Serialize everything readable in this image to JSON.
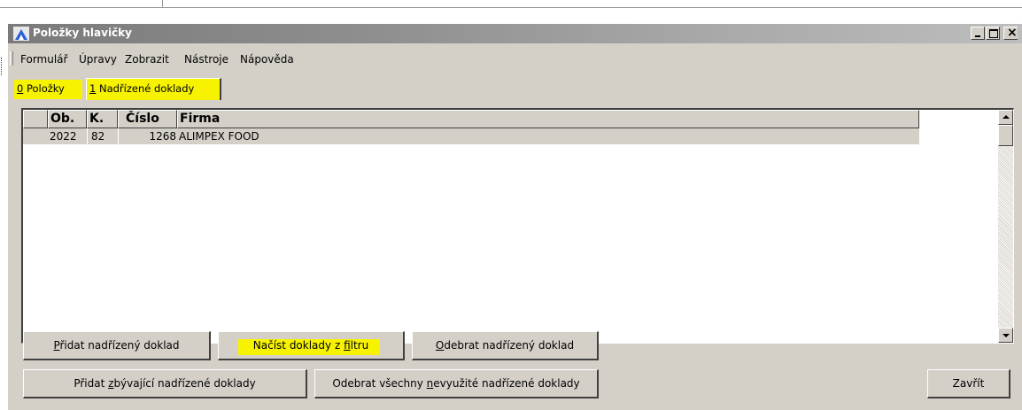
{
  "window": {
    "title": "Položky hlavičky",
    "controls": {
      "minimize": "minimize",
      "maximize": "maximize",
      "close": "×"
    }
  },
  "menu": [
    "Formulář",
    "Úpravy",
    "Zobrazit",
    "Nástroje",
    "Nápověda"
  ],
  "tabs": [
    {
      "key": "0",
      "label": " Položky",
      "highlighted": true,
      "active": false
    },
    {
      "key": "1",
      "label": " Nadřízené doklady",
      "highlighted": true,
      "active": true
    }
  ],
  "grid": {
    "columns": [
      "",
      "Ob.",
      "K.",
      "Číslo",
      "Firma"
    ],
    "rows": [
      {
        "ob": "2022",
        "k": "82",
        "cislo": "1268",
        "firma": "ALIMPEX FOOD"
      }
    ]
  },
  "buttons": {
    "pridat_prefix": "P",
    "pridat_rest": "řidat nadřízený doklad",
    "nacist_prefix": "Načíst doklady z ",
    "nacist_u": "f",
    "nacist_rest": "iltru",
    "odebrat_prefix": "O",
    "odebrat_rest": "debrat nadřízený doklad",
    "zbyvajici_prefix": "Přidat ",
    "zbyvajici_u": "z",
    "zbyvajici_rest": "bývající nadřízené doklady",
    "vsechny_prefix": "Odebrat všechny ",
    "vsechny_u": "n",
    "vsechny_rest": "evyužité nadřízené doklady",
    "zavrit": "Zavřít"
  },
  "colors": {
    "highlight": "#f7f300",
    "face": "#d4d0c8"
  }
}
